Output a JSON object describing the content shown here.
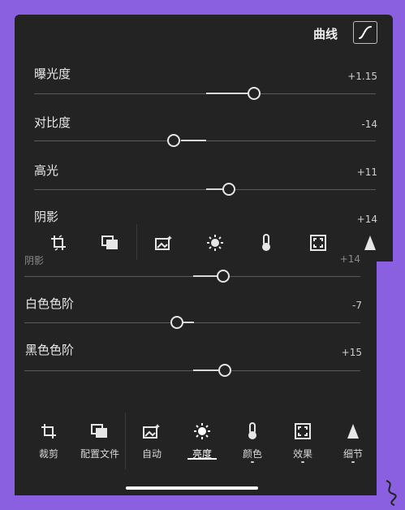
{
  "header": {
    "curve_label": "曲线"
  },
  "sliders": [
    {
      "label": "曝光度",
      "value": "+1.15",
      "position": 0.65
    },
    {
      "label": "对比度",
      "value": "-14",
      "position": 0.43
    },
    {
      "label": "高光",
      "value": "+11",
      "position": 0.56
    },
    {
      "label": "阴影",
      "value": "+14",
      "position": 0.57
    },
    {
      "label": "白色色阶",
      "value": "-7",
      "position": 0.46
    },
    {
      "label": "黑色色阶",
      "value": "+15",
      "position": 0.58
    }
  ],
  "occluded": {
    "label": "阴影",
    "value": "+14"
  },
  "toolbar_bottom": {
    "items": [
      {
        "icon": "crop-icon",
        "label": "裁剪"
      },
      {
        "icon": "profiles-icon",
        "label": "配置文件"
      },
      {
        "icon": "auto-icon",
        "label": "自动"
      },
      {
        "icon": "light-icon",
        "label": "亮度"
      },
      {
        "icon": "color-icon",
        "label": "颜色"
      },
      {
        "icon": "effects-icon",
        "label": "效果"
      },
      {
        "icon": "detail-icon",
        "label": "细节"
      }
    ],
    "active": "亮度"
  },
  "colors": {
    "panel": "#232323",
    "frame": "#8a5fe0",
    "accent": "#ffffff"
  }
}
